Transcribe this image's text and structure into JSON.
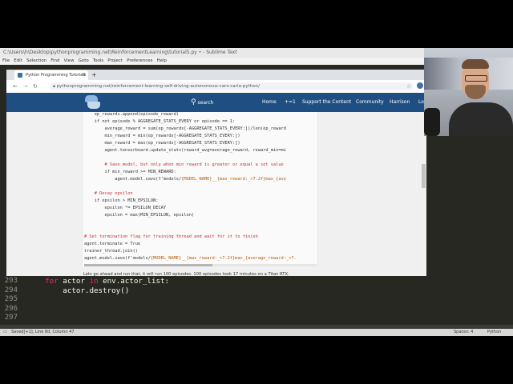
{
  "sublime": {
    "title": "C:\\Users\\h\\Desktop\\pythonprogramming.net\\ReinforcementLearning\\tutorial5.py • - Sublime Text",
    "menu": [
      "File",
      "Edit",
      "Selection",
      "Find",
      "View",
      "Goto",
      "Tools",
      "Project",
      "Preferences",
      "Help"
    ],
    "editor_lines": [
      {
        "num": "293",
        "parts": [
          {
            "t": "    "
          },
          {
            "t": "for",
            "k": 1
          },
          {
            "t": " actor "
          },
          {
            "t": "in",
            "k": 1
          },
          {
            "t": " env.actor_list:"
          }
        ]
      },
      {
        "num": "294",
        "parts": [
          {
            "t": "        actor.destroy()"
          }
        ]
      },
      {
        "num": "295",
        "parts": [
          {
            "t": ""
          }
        ]
      },
      {
        "num": "296",
        "parts": [
          {
            "t": ""
          }
        ]
      },
      {
        "num": "297",
        "parts": [
          {
            "t": ""
          }
        ]
      }
    ],
    "status_left": "Saved[+1], Line 8d, Column 47",
    "status_spaces": "Spaces: 4",
    "status_syntax": "Python"
  },
  "browser": {
    "tab_title": "Python Programming Tutorials",
    "url": "pythonprogramming.net/reinforcement-learning-self-driving-autonomous-cars-carla-python/",
    "nav": {
      "search": "search",
      "links": [
        "Home",
        "+=1",
        "Support the Content",
        "Community",
        "Harrison",
        "Lo"
      ]
    },
    "code_lines": [
      [
        {
          "t": "    ep_rewards.append(episode_reward)"
        }
      ],
      [
        {
          "t": "    if not episode % AGGREGATE_STATS_EVERY or episode == 1:"
        }
      ],
      [
        {
          "t": "        average_reward = sum(ep_rewards[-AGGREGATE_STATS_EVERY:])/len(ep_reward"
        }
      ],
      [
        {
          "t": "        min_reward = min(ep_rewards[-AGGREGATE_STATS_EVERY:])"
        }
      ],
      [
        {
          "t": "        max_reward = max(ep_rewards[-AGGREGATE_STATS_EVERY:])"
        }
      ],
      [
        {
          "t": "        agent.tensorboard.update_stats(reward_avg=average_reward, reward_min=mi"
        }
      ],
      [
        {
          "t": ""
        }
      ],
      [
        {
          "t": "        # Save model, but only when min reward is greater or equal a set value",
          "c": 1
        }
      ],
      [
        {
          "t": "        if min_reward >= MIN_REWARD:"
        }
      ],
      [
        {
          "t": "            agent.model.save(f'models/"
        },
        {
          "t": "{MODEL_NAME}__{max_reward:_>7.2f}max_{ave",
          "s": 1
        }
      ],
      [
        {
          "t": ""
        }
      ],
      [
        {
          "t": "    # Decay epsilon",
          "c": 1
        }
      ],
      [
        {
          "t": "    if epsilon > MIN_EPSILON:"
        }
      ],
      [
        {
          "t": "        epsilon *= EPSILON_DECAY"
        }
      ],
      [
        {
          "t": "        epsilon = max(MIN_EPSILON, epsilon)"
        }
      ],
      [
        {
          "t": ""
        }
      ],
      [
        {
          "t": ""
        }
      ],
      [
        {
          "t": "# Set termination flag for training thread and wait for it to finish",
          "c": 1
        }
      ],
      [
        {
          "t": "agent.terminate = True"
        }
      ],
      [
        {
          "t": "trainer_thread.join()"
        }
      ],
      [
        {
          "t": "agent.model.save(f'models/"
        },
        {
          "t": "{MODEL_NAME}__{max_reward:_>7.2f}max_{average_reward:_>7.",
          "s": 1
        }
      ]
    ],
    "paragraph": "Lets go ahead and run that, it will run 100 episodes. 100 episodes took 17 minutes on a Titan RTX."
  }
}
